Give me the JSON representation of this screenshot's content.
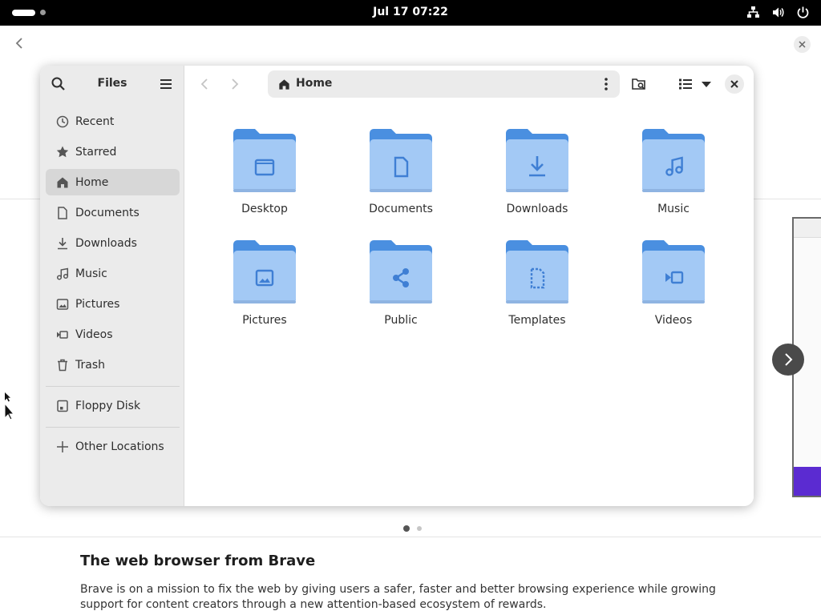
{
  "top_bar": {
    "clock": "Jul 17  07:22",
    "tray_icons": [
      "network-icon",
      "volume-icon",
      "power-icon"
    ]
  },
  "background_app": {
    "title": "The web browser from Brave",
    "description": "Brave is on a mission to fix the web by giving users a safer, faster and better browsing experience while growing support for content creators through a new attention-based ecosystem of rewards.",
    "carousel_page": 1,
    "carousel_pages": 2
  },
  "files": {
    "sidebar": {
      "title": "Files",
      "places": [
        {
          "label": "Recent",
          "icon": "clock-icon"
        },
        {
          "label": "Starred",
          "icon": "star-icon"
        },
        {
          "label": "Home",
          "icon": "home-icon",
          "active": true
        },
        {
          "label": "Documents",
          "icon": "document-icon"
        },
        {
          "label": "Downloads",
          "icon": "download-icon"
        },
        {
          "label": "Music",
          "icon": "music-icon"
        },
        {
          "label": "Pictures",
          "icon": "picture-icon"
        },
        {
          "label": "Videos",
          "icon": "video-icon"
        },
        {
          "label": "Trash",
          "icon": "trash-icon"
        }
      ],
      "devices": [
        {
          "label": "Floppy Disk",
          "icon": "floppy-icon"
        }
      ],
      "other": [
        {
          "label": "Other Locations",
          "icon": "plus-icon"
        }
      ]
    },
    "path": {
      "label": "Home"
    },
    "folders": [
      {
        "label": "Desktop",
        "icon": "folder-emblem-icon"
      },
      {
        "label": "Documents",
        "icon": "document-emblem-icon"
      },
      {
        "label": "Downloads",
        "icon": "download-emblem-icon"
      },
      {
        "label": "Music",
        "icon": "music-emblem-icon"
      },
      {
        "label": "Pictures",
        "icon": "picture-emblem-icon"
      },
      {
        "label": "Public",
        "icon": "share-emblem-icon"
      },
      {
        "label": "Templates",
        "icon": "template-emblem-icon"
      },
      {
        "label": "Videos",
        "icon": "video-emblem-icon"
      }
    ]
  },
  "colors": {
    "folder_back": "#4a8fe0",
    "folder_front": "#a3c9f5",
    "emblem": "#3f7fd4",
    "sidebar_bg": "#ebebeb",
    "sidebar_active": "#d7d7d7"
  }
}
